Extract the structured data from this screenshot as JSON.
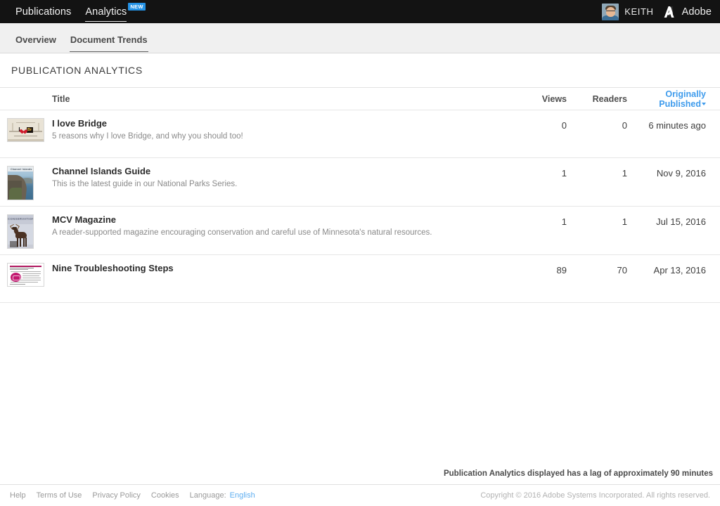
{
  "header": {
    "nav": [
      {
        "label": "Publications",
        "active": false,
        "badge": null
      },
      {
        "label": "Analytics",
        "active": true,
        "badge": "NEW"
      }
    ],
    "user_name": "KEITH",
    "brand": "Adobe",
    "badge_color": "#2492e5",
    "background": "#131313"
  },
  "subnav": {
    "items": [
      {
        "label": "Overview",
        "active": false
      },
      {
        "label": "Document Trends",
        "active": true
      }
    ]
  },
  "page": {
    "title": "PUBLICATION ANALYTICS"
  },
  "table": {
    "columns": {
      "title": "Title",
      "views": "Views",
      "readers": "Readers",
      "published": "Originally Published"
    },
    "sort": {
      "column": "Originally Published",
      "direction": "desc",
      "color": "#3e9bec"
    },
    "rows": [
      {
        "title": "I love Bridge",
        "description": "5 reasons why I love Bridge, and why you should too!",
        "views": "0",
        "readers": "0",
        "published": "6 minutes ago",
        "thumbnail": "bridge-poster-thumbnail"
      },
      {
        "title": "Channel Islands Guide",
        "description": "This is the latest guide in our National Parks Series.",
        "views": "1",
        "readers": "1",
        "published": "Nov 9, 2016",
        "thumbnail": "coastal-cliff-cover-thumbnail"
      },
      {
        "title": "MCV Magazine",
        "description": "A reader-supported magazine encouraging conservation and careful use of Minnesota's natural resources.",
        "views": "1",
        "readers": "1",
        "published": "Jul 15, 2016",
        "thumbnail": "moose-magazine-cover-thumbnail"
      },
      {
        "title": "Nine Troubleshooting Steps",
        "description": "",
        "views": "89",
        "readers": "70",
        "published": "Apr 13, 2016",
        "thumbnail": "document-page-thumbnail"
      }
    ]
  },
  "notice": {
    "text": "Publication Analytics displayed has a lag of approximately 90 minutes"
  },
  "footer": {
    "links": [
      "Help",
      "Terms of Use",
      "Privacy Policy",
      "Cookies"
    ],
    "language_label": "Language:",
    "language_value": "English",
    "copyright": "Copyright © 2016 Adobe Systems Incorporated. All rights reserved."
  }
}
